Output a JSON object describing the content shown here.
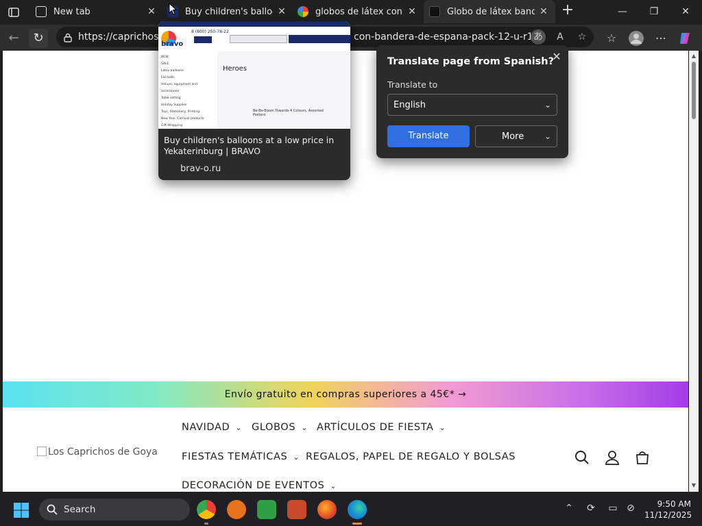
{
  "browser": {
    "tabs": [
      {
        "title": "New tab",
        "favicon": "new-tab-icon"
      },
      {
        "title": "Buy children's balloons at a low price in Yekaterinburg | BRAVO",
        "favicon": "bravo-icon"
      },
      {
        "title": "globos de látex con forma de bandera de España",
        "favicon": "google-icon"
      },
      {
        "title": "Globo de látex bandera de España",
        "favicon": "caprichos-icon",
        "active": true
      }
    ],
    "url_start": "https://caprichosde",
    "url_end": "con-bandera-de-espana-pack-12-u-r1..."
  },
  "tab_preview": {
    "title": "Buy children's balloons at a low price in Yekaterinburg | BRAVO",
    "domain": "brav-o.ru",
    "thumb": {
      "phone": "8 (800) 250-78-22",
      "logo": "bravo",
      "heading": "Heroes",
      "menu": [
        "NEW",
        "SALE",
        "Latex balloons",
        "Foil balls",
        "Helium, equipment and accessories",
        "Table setting",
        "Holiday Supplies",
        "Toys, Stationery, Printing",
        "New Year. Carnival products",
        "Gift Wrapping"
      ],
      "product": "Be-Be-Boom Towards 4 Colours, Assorted Posters"
    }
  },
  "translate_popup": {
    "heading": "Translate page from Spanish?",
    "label": "Translate to",
    "language": "English",
    "translate_btn": "Translate",
    "more_btn": "More"
  },
  "page": {
    "promo": "Envío gratuito en compras superiores a 45€* →",
    "logo_alt": "Los Caprichos de Goya",
    "menu": [
      {
        "label": "NAVIDAD",
        "has_dropdown": true
      },
      {
        "label": "GLOBOS",
        "has_dropdown": true
      },
      {
        "label": "ARTÍCULOS DE FIESTA",
        "has_dropdown": true
      },
      {
        "label": "FIESTAS TEMÁTICAS",
        "has_dropdown": true
      },
      {
        "label": "REGALOS, PAPEL DE REGALO Y BOLSAS",
        "has_dropdown": false
      },
      {
        "label": "DECORACIÓN DE EVENTOS",
        "has_dropdown": true
      }
    ]
  },
  "taskbar": {
    "search_label": "Search",
    "time": "9:50 AM",
    "date": "11/12/2025"
  },
  "colors": {
    "accent": "#2f6fe0",
    "chrome_bg": "#202020",
    "page_bg": "#ffffff"
  }
}
